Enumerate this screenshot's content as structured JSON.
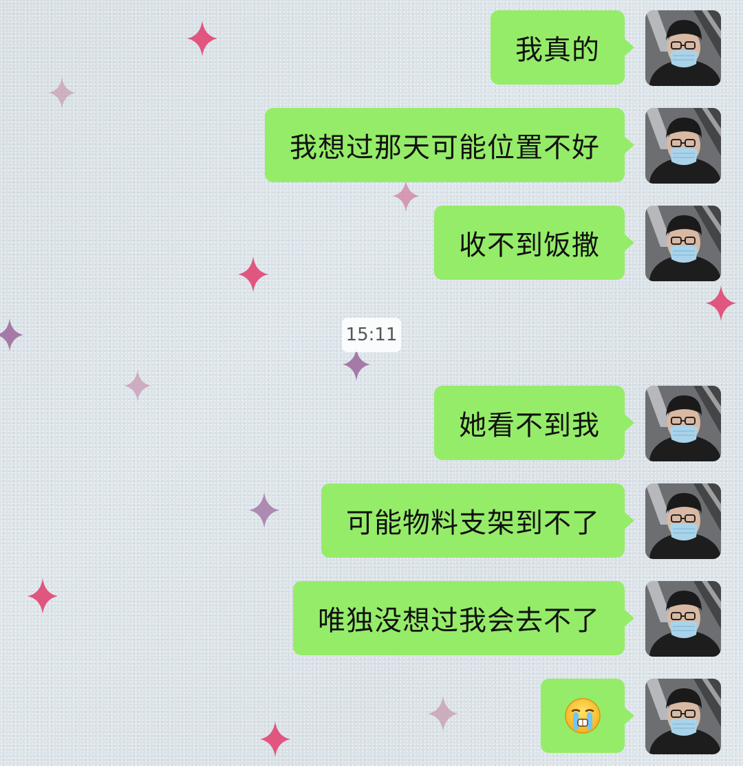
{
  "chat": {
    "timestamp": "15:11",
    "messages": [
      {
        "text": "我真的"
      },
      {
        "text": "我想过那天可能位置不好"
      },
      {
        "text": "收不到饭撒"
      },
      {
        "text": "她看不到我"
      },
      {
        "text": "可能物料支架到不了"
      },
      {
        "text": "唯独没想过我会去不了"
      },
      {
        "text": "",
        "emoji": "crying-face-emoji"
      }
    ]
  },
  "colors": {
    "bubble": "#95ec69",
    "background": "#dbe3e8",
    "sparkle_pink": "#e0567f",
    "sparkle_purple": "#a57aa8"
  },
  "icons": {
    "avatar": "user-avatar-masked-person",
    "sparkle": "sparkle-star-icon"
  }
}
